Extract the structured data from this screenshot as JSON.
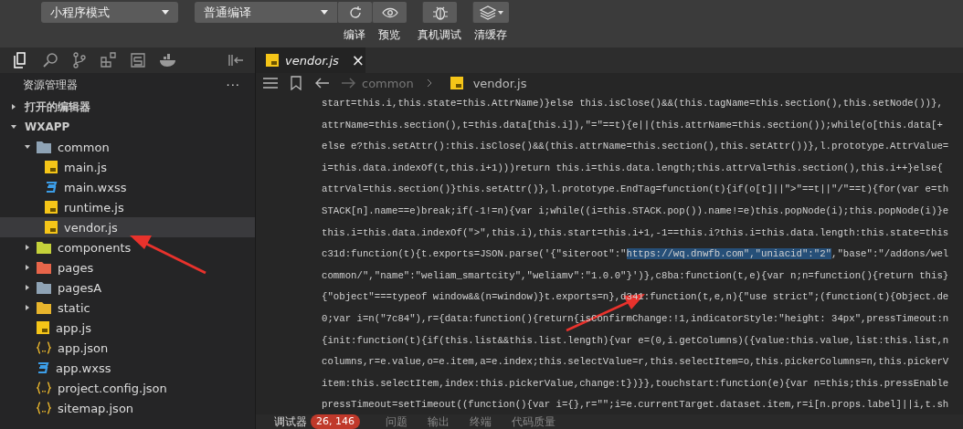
{
  "toolbar": {
    "mode_select": "小程序模式",
    "compile_select": "普通编译",
    "buttons": [
      {
        "kind": "refresh",
        "label": "编译"
      },
      {
        "kind": "eye",
        "label": "预览"
      },
      {
        "kind": "bug",
        "label": "真机调试"
      },
      {
        "kind": "layers",
        "label": "清缓存"
      }
    ]
  },
  "sidebar": {
    "title": "资源管理器",
    "more": "···",
    "sections": [
      {
        "label": "打开的编辑器",
        "expanded": false
      },
      {
        "label": "WXAPP",
        "expanded": true,
        "items": [
          {
            "kind": "folder",
            "label": "common",
            "color": "#8fa3b5",
            "expanded": true,
            "children": [
              {
                "kind": "js",
                "label": "main.js",
                "selected": false
              },
              {
                "kind": "wxss",
                "label": "main.wxss",
                "selected": false
              },
              {
                "kind": "js",
                "label": "runtime.js",
                "selected": false
              },
              {
                "kind": "js",
                "label": "vendor.js",
                "selected": true
              }
            ]
          },
          {
            "kind": "folder",
            "label": "components",
            "color": "#c5d13a",
            "expanded": false
          },
          {
            "kind": "folder",
            "label": "pages",
            "color": "#e8654a",
            "expanded": false
          },
          {
            "kind": "folder",
            "label": "pagesA",
            "color": "#8fa3b5",
            "expanded": false
          },
          {
            "kind": "folder",
            "label": "static",
            "color": "#e8b52c",
            "expanded": false
          },
          {
            "kind": "js",
            "label": "app.js",
            "selected": false
          },
          {
            "kind": "json",
            "label": "app.json",
            "selected": false
          },
          {
            "kind": "wxss",
            "label": "app.wxss",
            "selected": false
          },
          {
            "kind": "json",
            "label": "project.config.json",
            "selected": false
          },
          {
            "kind": "json",
            "label": "sitemap.json",
            "selected": false
          }
        ]
      }
    ]
  },
  "editor": {
    "tab": {
      "label": "vendor.js",
      "close": "×"
    },
    "breadcrumb": [
      "common",
      "vendor.js"
    ],
    "lines": [
      {
        "segments": [
          {
            "text": "start=this.i,this.state=this.AttrName)}else this.isClose()&&(this.tagName=this.section(),this.setNode())},",
            "selected": false
          }
        ]
      },
      {
        "segments": [
          {
            "text": "attrName=this.section(),t=this.data[this.i]),\"=\"==t){e||(this.attrName=this.section());while(o[this.data[+",
            "selected": false
          }
        ]
      },
      {
        "segments": [
          {
            "text": "else e?this.setAttr():this.isClose()&&(this.attrName=this.section(),this.setAttr())},l.prototype.AttrValue=",
            "selected": false
          }
        ]
      },
      {
        "segments": [
          {
            "text": "i=this.data.indexOf(t,this.i+1)))return this.i=this.data.length;this.attrVal=this.section(),this.i++}else{",
            "selected": false
          }
        ]
      },
      {
        "segments": [
          {
            "text": "attrVal=this.section()}this.setAttr()},l.prototype.EndTag=function(t){if(o[t]||\">\"==t||\"/\"==t){for(var e=th",
            "selected": false
          }
        ]
      },
      {
        "segments": [
          {
            "text": "STACK[n].name==e)break;if(-1!=n){var i;while((i=this.STACK.pop()).name!=e)this.popNode(i);this.popNode(i)}e",
            "selected": false
          }
        ]
      },
      {
        "segments": [
          {
            "text": "this.i=this.data.indexOf(\">\",this.i),this.start=this.i+1,-1==this.i?this.i=this.data.length:this.state=this",
            "selected": false
          }
        ]
      },
      {
        "segments": [
          {
            "text": "c31d:function(t){t.exports=JSON.parse('{\"siteroot\":\"",
            "selected": false
          },
          {
            "text": "https://wq.dnwfb.com\",\"uniacid\":\"2\"",
            "selected": true
          },
          {
            "text": ",\"base\":\"/addons/wel",
            "selected": false
          }
        ]
      },
      {
        "segments": [
          {
            "text": "common/\",\"name\":\"weliam_smartcity\",\"weliamv\":\"1.0.0\"}')},c8ba:function(t,e){var n;n=function(){return this}",
            "selected": false
          }
        ]
      },
      {
        "segments": [
          {
            "text": "{\"object\"===typeof window&&(n=window)}t.exports=n},d341:function(t,e,n){\"use strict\";(function(t){Object.de",
            "selected": false
          }
        ]
      },
      {
        "segments": [
          {
            "text": "0;var i=n(\"7c84\"),r={data:function(){return{isConfirmChange:!1,indicatorStyle:\"height: 34px\",pressTimeout:n",
            "selected": false
          }
        ]
      },
      {
        "segments": [
          {
            "text": "{init:function(t){if(this.list&&this.list.length){var e=(0,i.getColumns)({value:this.value,list:this.list,n",
            "selected": false
          }
        ]
      },
      {
        "segments": [
          {
            "text": "columns,r=e.value,o=e.item,a=e.index;this.selectValue=r,this.selectItem=o,this.pickerColumns=n,this.pickerV",
            "selected": false
          }
        ]
      },
      {
        "segments": [
          {
            "text": "item:this.selectItem,index:this.pickerValue,change:t})}},touchstart:function(e){var n=this;this.pressEnable",
            "selected": false
          }
        ]
      },
      {
        "segments": [
          {
            "text": "pressTimeout=setTimeout((function(){var i={},r=\"\";i=e.currentTarget.dataset.item,r=i[n.props.label]||i,t.sh",
            "selected": false
          }
        ]
      }
    ]
  },
  "panel": {
    "tabs": [
      {
        "label": "调试器",
        "badge": "26, 146",
        "selected": true
      },
      {
        "label": "问题",
        "selected": false
      },
      {
        "label": "输出",
        "selected": false
      },
      {
        "label": "终端",
        "selected": false
      },
      {
        "label": "代码质量",
        "selected": false
      }
    ]
  }
}
